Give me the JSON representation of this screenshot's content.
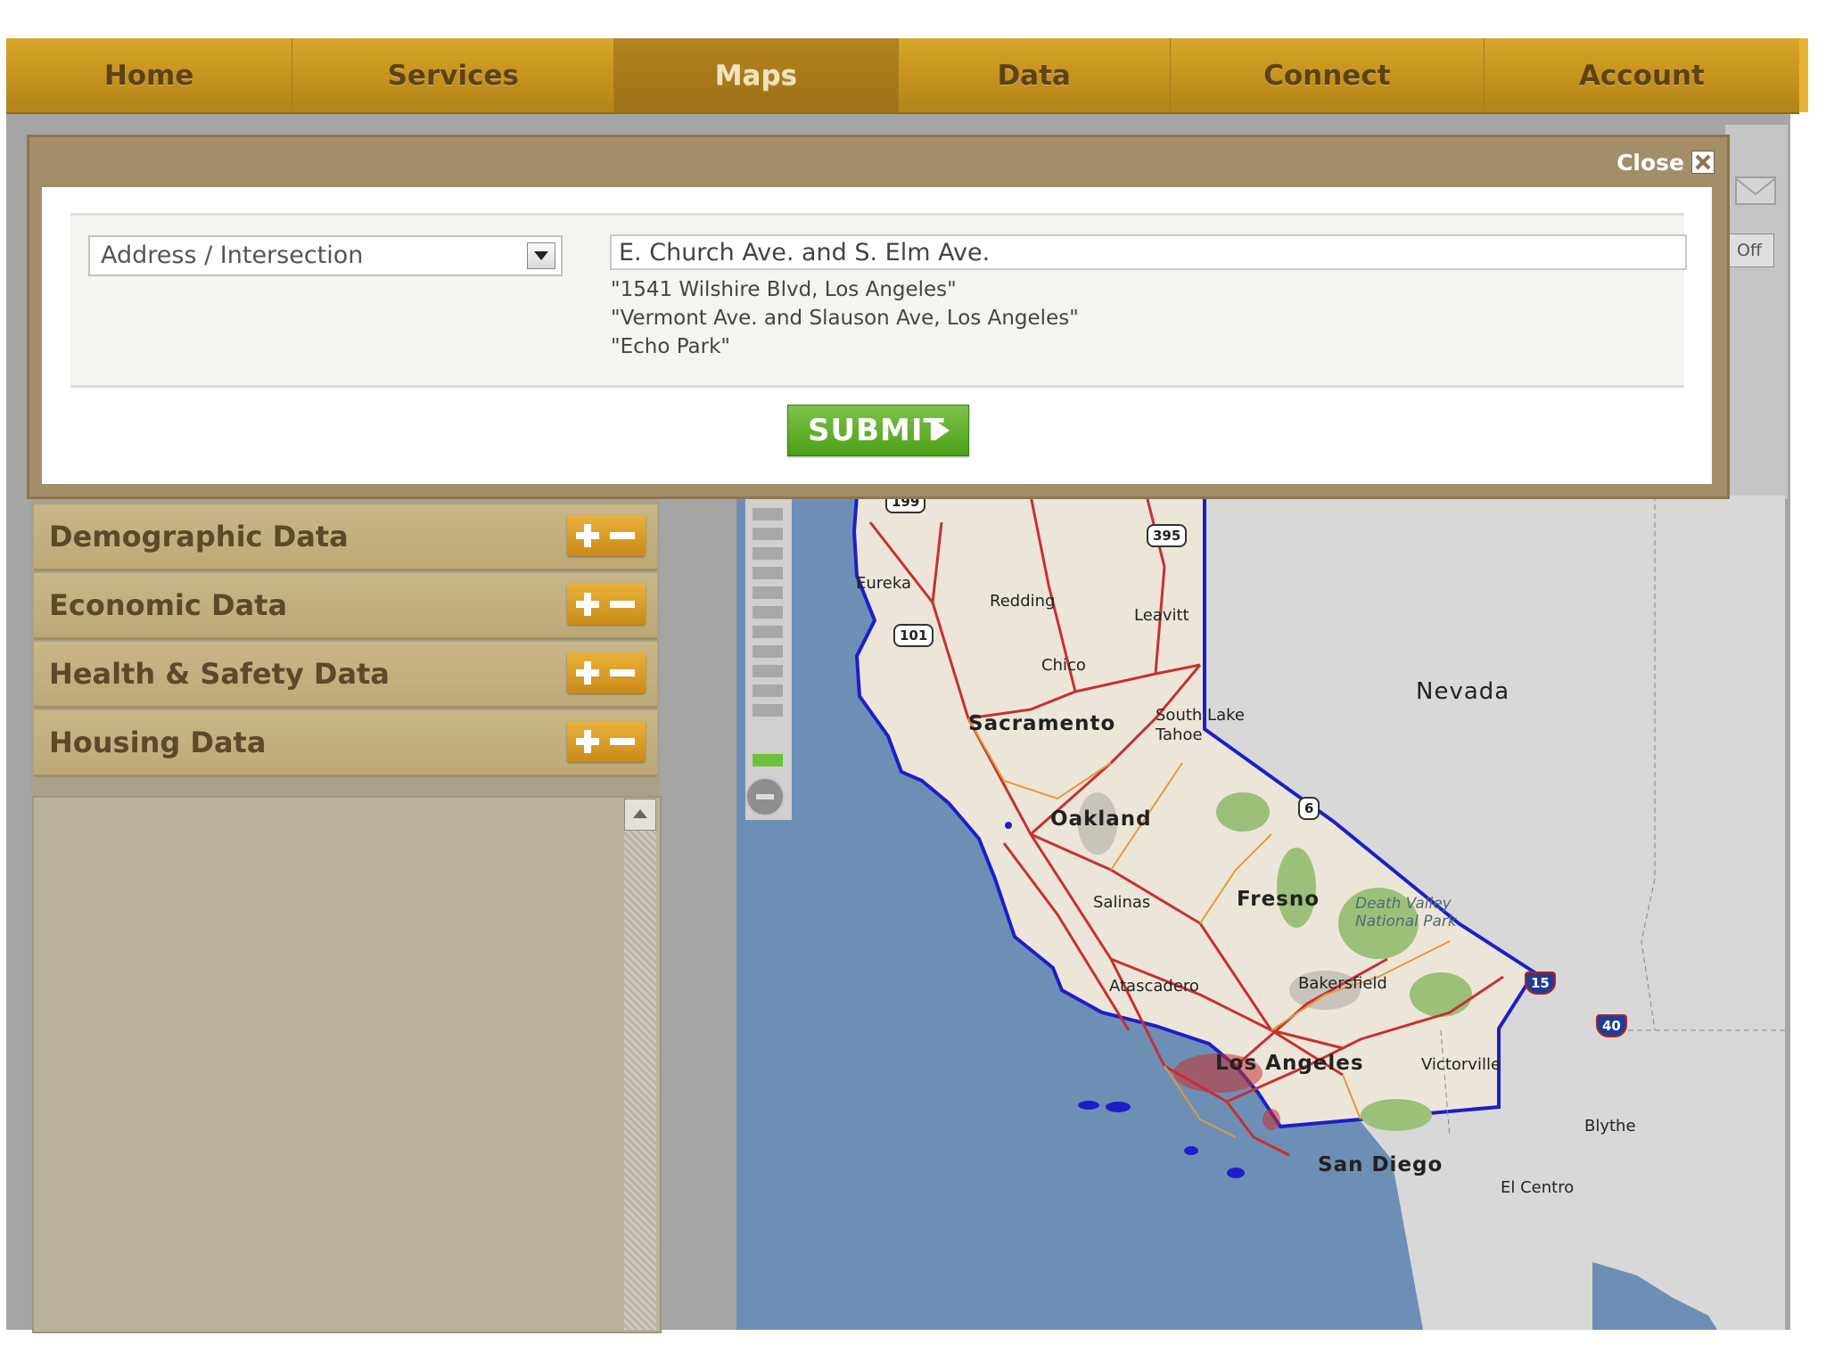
{
  "nav": {
    "items": [
      {
        "label": "Home",
        "active": false
      },
      {
        "label": "Services",
        "active": false
      },
      {
        "label": "Maps",
        "active": true
      },
      {
        "label": "Data",
        "active": false
      },
      {
        "label": "Connect",
        "active": false
      },
      {
        "label": "Account",
        "active": false
      }
    ]
  },
  "dialog": {
    "close_label": "Close",
    "search_type": {
      "selected": "Address / Intersection"
    },
    "address_input": {
      "value": "E. Church Ave. and S. Elm Ave."
    },
    "examples": [
      "\"1541 Wilshire Blvd, Los Angeles\"",
      "\"Vermont Ave. and Slauson Ave, Los Angeles\"",
      "\"Echo Park\""
    ],
    "submit_label": "SUBMIT"
  },
  "sidebar": {
    "panels": [
      {
        "label": "Demographic Data"
      },
      {
        "label": "Economic Data"
      },
      {
        "label": "Health & Safety Data"
      },
      {
        "label": "Housing Data"
      }
    ]
  },
  "right_panel": {
    "toggle_label": "Off"
  },
  "map": {
    "state_label": "Nevada",
    "cities_major": [
      "Sacramento",
      "Oakland",
      "Fresno",
      "Los Angeles",
      "San Diego"
    ],
    "cities_minor": [
      "Eureka",
      "Redding",
      "Leavitt",
      "Chico",
      "South Lake",
      "Tahoe",
      "Salinas",
      "Atascadero",
      "Bakersfield",
      "Victorville",
      "Blythe",
      "El Centro"
    ],
    "park": [
      "Death Valley",
      "National Park"
    ],
    "highway_shields": [
      "199",
      "395",
      "101",
      "6"
    ],
    "interstate_shields": [
      "15",
      "40"
    ],
    "colors": {
      "ocean": "#6d8fb5",
      "land": "#ece6d9",
      "border": "#1e1ec8",
      "roads": "#c83030"
    }
  }
}
